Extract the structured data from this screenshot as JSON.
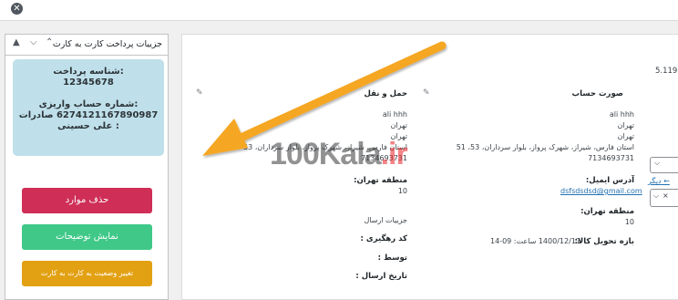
{
  "sidebar": {
    "title": "جزییات پرداخت کارت به کارت",
    "payment_id_label": "شناسه پرداخت:",
    "payment_id": "12345678",
    "account_label": "شماره حساب واریزی:",
    "account_value": "6274121167890987 صادرات : علی حسینی",
    "delete_label": "حذف موارد",
    "show_notes_label": "نمایش توضیحات",
    "change_status_label": "تغییر وضعیت به کارت به کارت"
  },
  "main": {
    "version": "5.119",
    "shipping": {
      "heading": "حمل و نقل",
      "name": "ali hhh",
      "city1": "تهران",
      "city2": "تهران",
      "address": "استان فارس، شیراز، شهرک پرواز، بلوار سرداران، 53، 51",
      "postcode": "7134693731",
      "region_label": "منطقه تهران:",
      "region_value": "10",
      "details_label": "جزییات ارسال",
      "tracking_label": "کد رهگیری :",
      "by_label": "توسط :",
      "date_label": "تاریخ ارسال :"
    },
    "billing": {
      "heading": "صورت حساب",
      "name": "ali hhh",
      "city1": "تهران",
      "city2": "تهران",
      "address": "استان فارس، شیراز، شهرک پرواز، بلوار سرداران، 53، 51",
      "postcode": "7134693731",
      "email_label": "آدرس ایمیل:",
      "email": "dsfsdsdsd@gmail.com",
      "region_label": "منطقه تهران:",
      "region_value": "10",
      "delivery_label": "بازه تحویل کالا:",
      "delivery_value": "1400/12/17 ساعت: 09-14"
    },
    "right_link": "دیگر ←"
  },
  "watermark": {
    "prefix": "100",
    "brand": "Kala",
    "suffix": ".ir"
  },
  "colors": {
    "delete": "#cf2e57",
    "show": "#3fc888",
    "status": "#e2a013",
    "info_bg": "#bfe0ea",
    "arrow": "#f5a623"
  }
}
